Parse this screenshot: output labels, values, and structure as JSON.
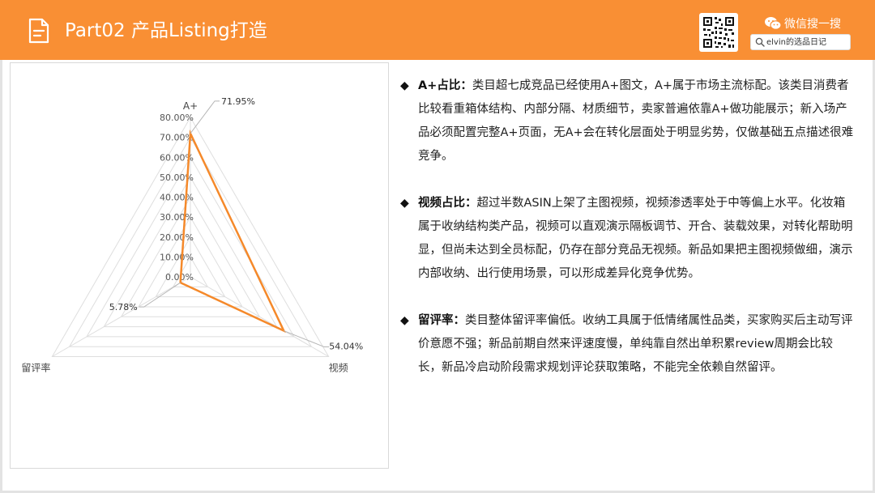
{
  "header": {
    "title": "Part02 产品Listing打造",
    "wechat_label": "微信搜一搜",
    "search_text": "elvin的选品日记",
    "accent_color": "#f98f34",
    "icons": [
      "document-icon",
      "qr-code-icon",
      "wechat-icon",
      "search-icon"
    ]
  },
  "chart_data": {
    "type": "radar",
    "axes": [
      "A+",
      "视频",
      "留评率"
    ],
    "values": [
      71.95,
      54.04,
      5.78
    ],
    "data_labels": [
      "71.95%",
      "54.04%",
      "5.78%"
    ],
    "tick_labels": [
      "0.00%",
      "10.00%",
      "20.00%",
      "30.00%",
      "40.00%",
      "50.00%",
      "60.00%",
      "70.00%",
      "80.00%"
    ],
    "rmax": 80,
    "grid": true,
    "series_color": "#f5892a"
  },
  "bullets": [
    {
      "lead": "A+占比：",
      "text": "类目超七成竞品已经使用A+图文，A+属于市场主流标配。该类目消费者比较看重箱体结构、内部分隔、材质细节，卖家普遍依靠A+做功能展示；新入场产品必须配置完整A+页面，无A+会在转化层面处于明显劣势，仅做基础五点描述很难竞争。"
    },
    {
      "lead": "视频占比：",
      "text": "超过半数ASIN上架了主图视频，视频渗透率处于中等偏上水平。化妆箱属于收纳结构类产品，视频可以直观演示隔板调节、开合、装载效果，对转化帮助明显，但尚未达到全员标配，仍存在部分竞品无视频。新品如果把主图视频做细，演示内部收纳、出行使用场景，可以形成差异化竞争优势。"
    },
    {
      "lead": "留评率：",
      "text": "类目整体留评率偏低。收纳工具属于低情绪属性品类，买家购买后主动写评价意愿不强；新品前期自然来评速度慢，单纯靠自然出单积累review周期会比较长，新品冷启动阶段需求规划评论获取策略，不能完全依赖自然留评。"
    }
  ]
}
